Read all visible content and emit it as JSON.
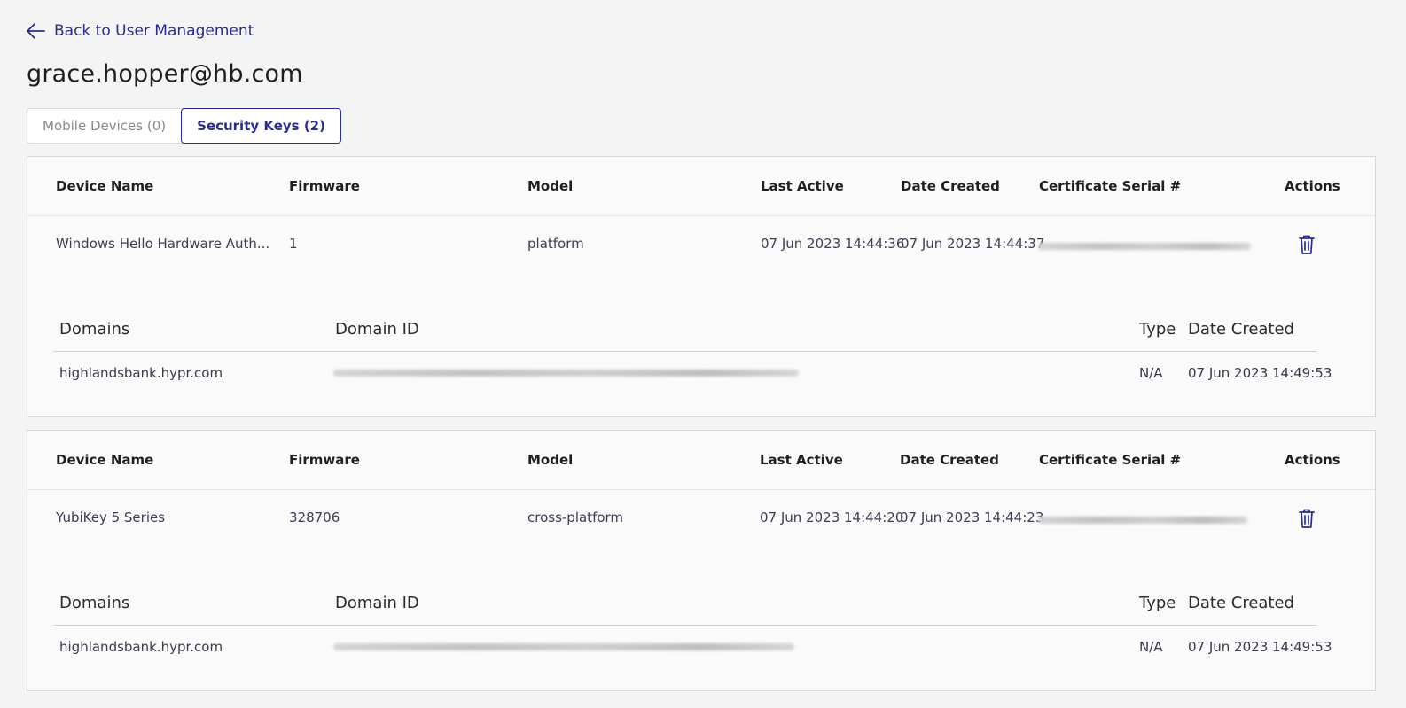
{
  "nav": {
    "back_label": "Back to User Management"
  },
  "page": {
    "title": "grace.hopper@hb.com"
  },
  "tabs": [
    {
      "label": "Mobile Devices (0)",
      "active": false
    },
    {
      "label": "Security Keys (2)",
      "active": true
    }
  ],
  "columns": {
    "device_name": "Device Name",
    "firmware": "Firmware",
    "model": "Model",
    "last_active": "Last Active",
    "date_created": "Date Created",
    "cert_serial": "Certificate Serial #",
    "actions": "Actions"
  },
  "domain_columns": {
    "domains": "Domains",
    "domain_id": "Domain ID",
    "type": "Type",
    "date_created": "Date Created"
  },
  "devices": [
    {
      "device_name": "Windows Hello Hardware Auth...",
      "firmware": "1",
      "model": "platform",
      "last_active": "07 Jun 2023 14:44:36",
      "date_created": "07 Jun 2023 14:44:37",
      "domain": {
        "name": "highlandsbank.hypr.com",
        "type": "N/A",
        "date_created": "07 Jun 2023 14:49:53"
      }
    },
    {
      "device_name": "YubiKey 5 Series",
      "firmware": "328706",
      "model": "cross-platform",
      "last_active": "07 Jun 2023 14:44:20",
      "date_created": "07 Jun 2023 14:44:23",
      "domain": {
        "name": "highlandsbank.hypr.com",
        "type": "N/A",
        "date_created": "07 Jun 2023 14:49:53"
      }
    }
  ],
  "colors": {
    "accent": "#2a2d8f",
    "background": "#f4f4f4",
    "card": "#fafafa"
  },
  "icons": {
    "back": "arrow-left-icon",
    "delete": "trash-icon"
  }
}
